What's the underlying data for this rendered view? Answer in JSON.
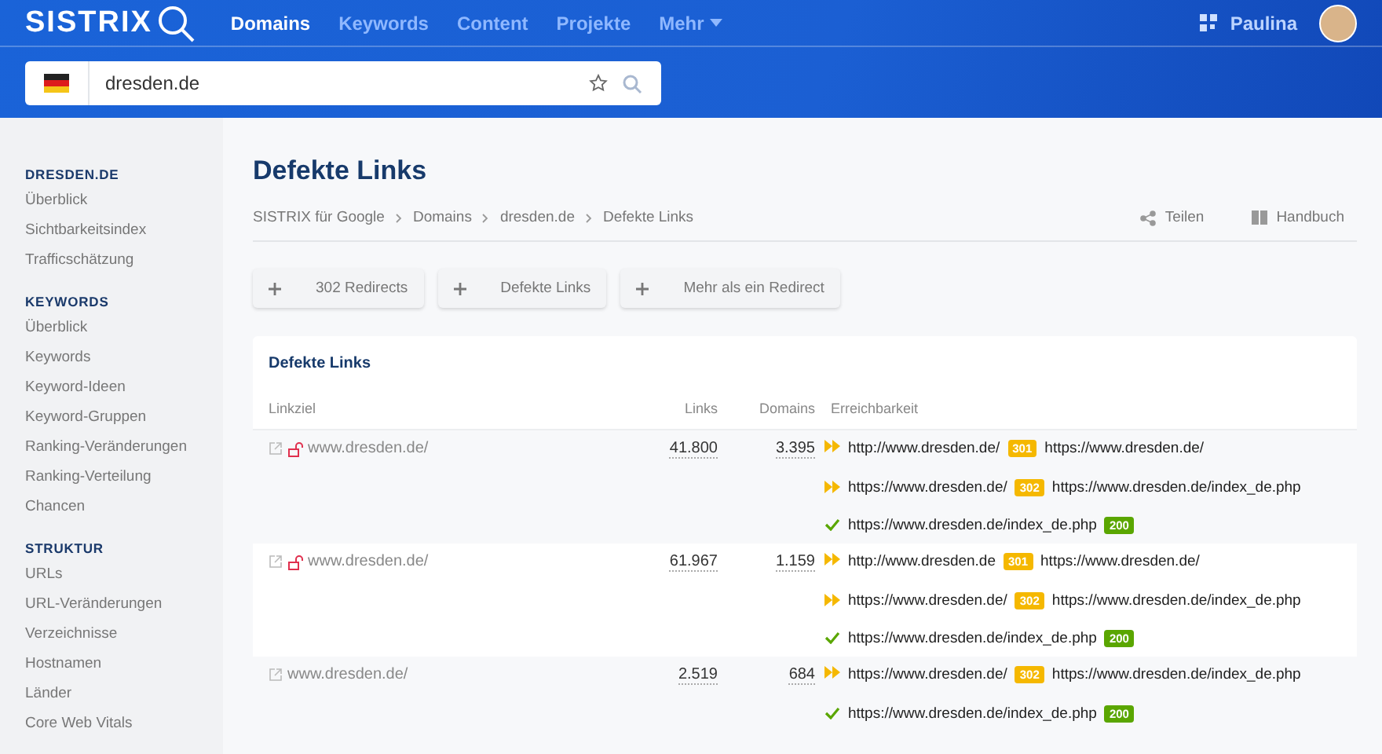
{
  "header": {
    "logo": "SISTRIX",
    "nav": [
      {
        "label": "Domains",
        "selected": true,
        "kind": "link"
      },
      {
        "label": "Keywords",
        "selected": false,
        "kind": "link"
      },
      {
        "label": "Content",
        "selected": false,
        "kind": "link"
      },
      {
        "label": "Projekte",
        "selected": false,
        "kind": "link"
      },
      {
        "label": "Mehr",
        "selected": false,
        "kind": "dropdown"
      }
    ],
    "user": "Paulina"
  },
  "search": {
    "value": "dresden.de"
  },
  "sidebar": {
    "sections": [
      {
        "title": "DRESDEN.DE",
        "items": [
          "Überblick",
          "Sichtbarkeitsindex",
          "Trafficschätzung"
        ]
      },
      {
        "title": "KEYWORDS",
        "items": [
          "Überblick",
          "Keywords",
          "Keyword-Ideen",
          "Keyword-Gruppen",
          "Ranking-Veränderungen",
          "Ranking-Verteilung",
          "Chancen"
        ]
      },
      {
        "title": "STRUKTUR",
        "items": [
          "URLs",
          "URL-Veränderungen",
          "Verzeichnisse",
          "Hostnamen",
          "Länder",
          "Core Web Vitals"
        ]
      }
    ]
  },
  "page": {
    "title": "Defekte Links",
    "breadcrumb": [
      "SISTRIX für Google",
      "Domains",
      "dresden.de",
      "Defekte Links"
    ],
    "actions": [
      {
        "label": "Teilen",
        "kind": "share"
      },
      {
        "label": "Handbuch",
        "kind": "book"
      }
    ],
    "filters": [
      "302 Redirects",
      "Defekte Links",
      "Mehr als ein Redirect"
    ]
  },
  "table": {
    "title": "Defekte Links",
    "columns": [
      "Linkziel",
      "Links",
      "Domains",
      "Erreichbarkeit"
    ],
    "rows": [
      {
        "target": "www.dresden.de/",
        "insecure": true,
        "links": "41.800",
        "domains": "3.395",
        "hops": [
          {
            "kind": "redirect",
            "from": "http://www.dresden.de/",
            "code": "301",
            "to": "https://www.dresden.de/"
          },
          {
            "kind": "redirect",
            "from": "https://www.dresden.de/",
            "code": "302",
            "to": "https://www.dresden.de/index_de.php"
          },
          {
            "kind": "ok",
            "from": "https://www.dresden.de/index_de.php",
            "code": "200"
          }
        ]
      },
      {
        "target": "www.dresden.de/",
        "insecure": true,
        "links": "61.967",
        "domains": "1.159",
        "hops": [
          {
            "kind": "redirect",
            "from": "http://www.dresden.de",
            "code": "301",
            "to": "https://www.dresden.de/"
          },
          {
            "kind": "redirect",
            "from": "https://www.dresden.de/",
            "code": "302",
            "to": "https://www.dresden.de/index_de.php"
          },
          {
            "kind": "ok",
            "from": "https://www.dresden.de/index_de.php",
            "code": "200"
          }
        ]
      },
      {
        "target": "www.dresden.de/",
        "insecure": false,
        "links": "2.519",
        "domains": "684",
        "hops": [
          {
            "kind": "redirect",
            "from": "https://www.dresden.de/",
            "code": "302",
            "to": "https://www.dresden.de/index_de.php"
          },
          {
            "kind": "ok",
            "from": "https://www.dresden.de/index_de.php",
            "code": "200"
          }
        ]
      }
    ]
  }
}
